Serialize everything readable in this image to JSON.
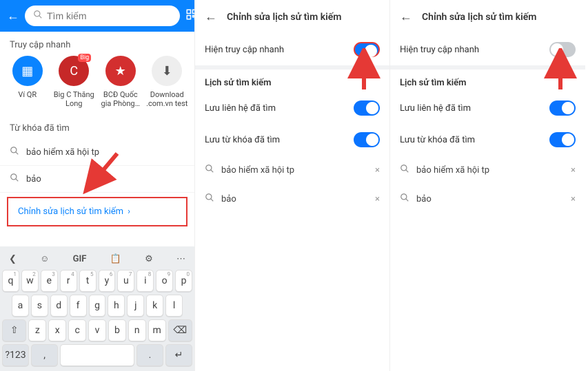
{
  "panel1": {
    "search_placeholder": "Tìm kiếm",
    "quick_label": "Truy cập nhanh",
    "quick": [
      {
        "name": "Ví QR"
      },
      {
        "name": "Big C Thăng Long"
      },
      {
        "name": "BCĐ Quốc gia Phòng…"
      },
      {
        "name": "Download .com.vn test"
      }
    ],
    "history_label": "Từ khóa đã tìm",
    "history": [
      "bảo hiểm xã hội tp",
      "bảo"
    ],
    "edit_label": "Chỉnh sửa lịch sử tìm kiếm",
    "keyboard": {
      "toprow": [
        "❮",
        "☺",
        "GIF",
        "📋",
        "⚙",
        "⋯"
      ],
      "rows": [
        [
          [
            "q",
            "1"
          ],
          [
            "w",
            "2"
          ],
          [
            "e",
            "3"
          ],
          [
            "r",
            "4"
          ],
          [
            "t",
            "5"
          ],
          [
            "y",
            "6"
          ],
          [
            "u",
            "7"
          ],
          [
            "i",
            "8"
          ],
          [
            "o",
            "9"
          ],
          [
            "p",
            "0"
          ]
        ],
        [
          [
            "a",
            ""
          ],
          [
            "s",
            ""
          ],
          [
            "d",
            ""
          ],
          [
            "f",
            ""
          ],
          [
            "g",
            ""
          ],
          [
            "h",
            ""
          ],
          [
            "j",
            ""
          ],
          [
            "k",
            ""
          ],
          [
            "l",
            ""
          ]
        ],
        [
          [
            "⇧",
            ""
          ],
          [
            "z",
            ""
          ],
          [
            "x",
            ""
          ],
          [
            "c",
            ""
          ],
          [
            "v",
            ""
          ],
          [
            "b",
            ""
          ],
          [
            "n",
            ""
          ],
          [
            "m",
            ""
          ],
          [
            "⌫",
            ""
          ]
        ],
        [
          [
            "?123",
            ""
          ],
          [
            ",",
            ""
          ],
          [
            "space",
            ""
          ],
          [
            ".",
            ""
          ],
          [
            "↵",
            ""
          ]
        ]
      ]
    }
  },
  "panel2": {
    "title": "Chỉnh sửa lịch sử tìm kiếm",
    "quick_toggle_label": "Hiện truy cập nhanh",
    "quick_toggle_on": true,
    "history_label": "Lịch sử tìm kiếm",
    "opt_contacts": "Lưu liên hệ đã tìm",
    "opt_keywords": "Lưu từ khóa đã tìm",
    "history": [
      "bảo hiểm xã hội tp",
      "bảo"
    ]
  },
  "panel3": {
    "title": "Chỉnh sửa lịch sử tìm kiếm",
    "quick_toggle_label": "Hiện truy cập nhanh",
    "quick_toggle_on": false,
    "history_label": "Lịch sử tìm kiếm",
    "opt_contacts": "Lưu liên hệ đã tìm",
    "opt_keywords": "Lưu từ khóa đã tìm",
    "history": [
      "bảo hiểm xã hội tp",
      "bảo"
    ]
  }
}
